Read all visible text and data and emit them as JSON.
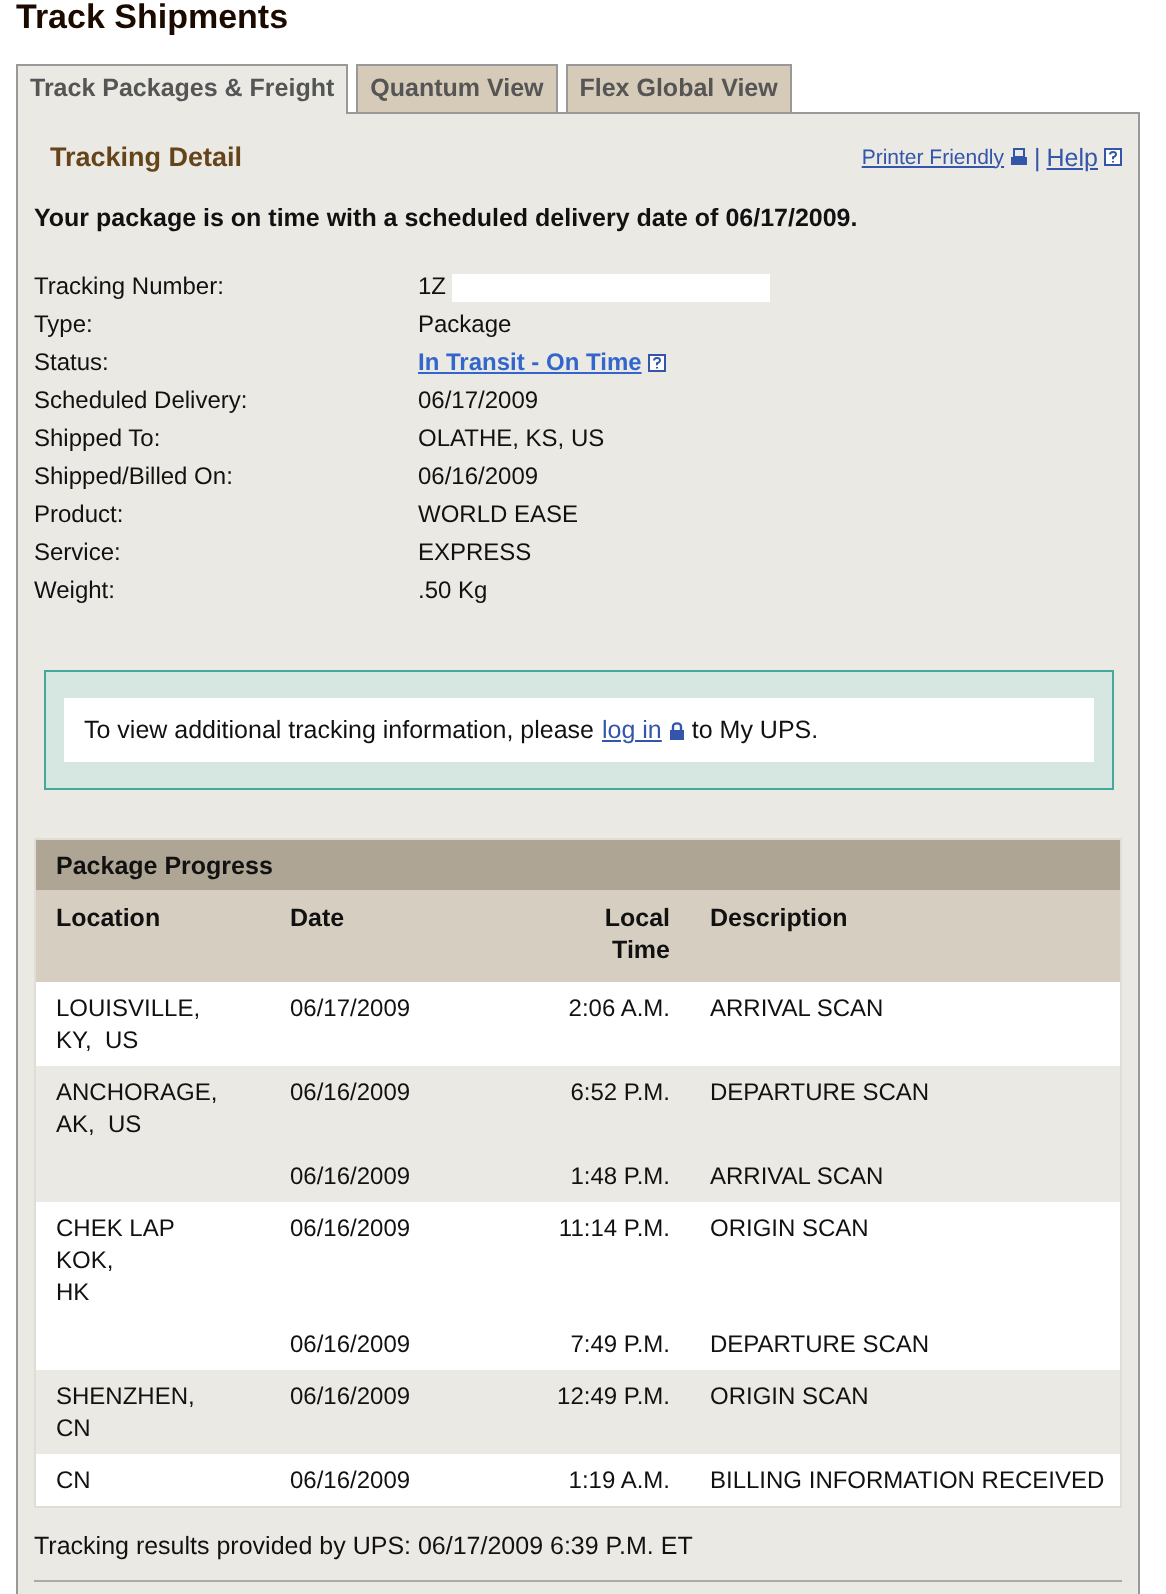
{
  "page_title": "Track Shipments",
  "tabs": [
    {
      "label": "Track Packages & Freight",
      "selected": true
    },
    {
      "label": "Quantum View",
      "selected": false
    },
    {
      "label": "Flex Global View",
      "selected": false
    }
  ],
  "section_title": "Tracking Detail",
  "links": {
    "printer": "Printer Friendly",
    "separator": "|",
    "help": "Help"
  },
  "summary": "Your package is on time with a scheduled delivery date of 06/17/2009.",
  "details": [
    {
      "label": "Tracking Number:",
      "value": "1Z",
      "kind": "redacted"
    },
    {
      "label": "Type:",
      "value": "Package",
      "kind": "text"
    },
    {
      "label": "Status:",
      "value": "In Transit - On Time",
      "kind": "link"
    },
    {
      "label": "Scheduled Delivery:",
      "value": "06/17/2009",
      "kind": "text"
    },
    {
      "label": "Shipped To:",
      "value": "OLATHE, KS, US",
      "kind": "text"
    },
    {
      "label": "Shipped/Billed On:",
      "value": "06/16/2009",
      "kind": "text"
    },
    {
      "label": "Product:",
      "value": "WORLD EASE",
      "kind": "text"
    },
    {
      "label": "Service:",
      "value": "EXPRESS",
      "kind": "text"
    },
    {
      "label": "Weight:",
      "value": ".50 Kg",
      "kind": "text"
    }
  ],
  "notice": {
    "before": "To view additional tracking information, please",
    "link": "log in",
    "after": "to My UPS."
  },
  "progress": {
    "title": "Package Progress",
    "columns": [
      "Location",
      "Date",
      "Local\nTime",
      "Description"
    ],
    "groups": [
      {
        "location": "LOUISVILLE,\nKY,  US",
        "events": [
          {
            "date": "06/17/2009",
            "time": "2:06 A.M.",
            "description": "ARRIVAL SCAN"
          }
        ]
      },
      {
        "location": "ANCHORAGE,\nAK,  US",
        "events": [
          {
            "date": "06/16/2009",
            "time": "6:52 P.M.",
            "description": "DEPARTURE SCAN"
          },
          {
            "date": "06/16/2009",
            "time": "1:48 P.M.",
            "description": "ARRIVAL SCAN"
          }
        ]
      },
      {
        "location": "CHEK LAP\nKOK,\nHK",
        "events": [
          {
            "date": "06/16/2009",
            "time": "11:14 P.M.",
            "description": "ORIGIN SCAN"
          },
          {
            "date": "06/16/2009",
            "time": "7:49 P.M.",
            "description": "DEPARTURE SCAN"
          }
        ]
      },
      {
        "location": "SHENZHEN,\nCN",
        "events": [
          {
            "date": "06/16/2009",
            "time": "12:49 P.M.",
            "description": "ORIGIN SCAN"
          }
        ]
      },
      {
        "location": "CN",
        "events": [
          {
            "date": "06/16/2009",
            "time": "1:19 A.M.",
            "description": "BILLING INFORMATION RECEIVED"
          }
        ]
      }
    ]
  },
  "footer": "Tracking results provided by UPS:  06/17/2009 6:39 P.M.  ET"
}
